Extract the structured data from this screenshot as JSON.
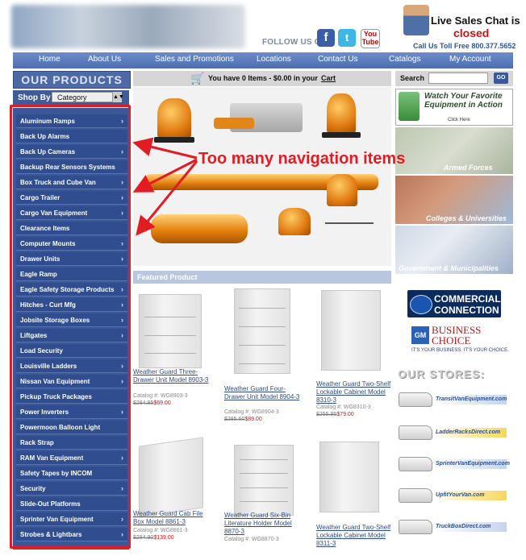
{
  "header": {
    "follow_us": "FOLLOW US ON",
    "social": {
      "facebook": "f",
      "twitter": "t",
      "youtube": "You Tube"
    },
    "chat_title": "Live Sales Chat is",
    "chat_status": "closed",
    "phone": "Call Us Toll Free 800.377.5652"
  },
  "nav": [
    "Home",
    "About Us",
    "Sales and Promotions",
    "Locations",
    "Contact Us",
    "Catalogs",
    "My Account"
  ],
  "sidebar": {
    "title": "OUR PRODUCTS",
    "shop_by": "Shop By",
    "category": "Category",
    "items": [
      {
        "label": "Aluminum Ramps",
        "arrow": true
      },
      {
        "label": "Back Up Alarms",
        "arrow": false
      },
      {
        "label": "Back Up Cameras",
        "arrow": true
      },
      {
        "label": "Backup Rear Sensors Systems",
        "arrow": false
      },
      {
        "label": "Box Truck and Cube Van",
        "arrow": true
      },
      {
        "label": "Cargo Trailer",
        "arrow": true
      },
      {
        "label": "Cargo Van Equipment",
        "arrow": true
      },
      {
        "label": "Clearance Items",
        "arrow": false
      },
      {
        "label": "Computer Mounts",
        "arrow": true
      },
      {
        "label": "Drawer Units",
        "arrow": true
      },
      {
        "label": "Eagle Ramp",
        "arrow": false
      },
      {
        "label": "Eagle Safety Storage Products",
        "arrow": true
      },
      {
        "label": "Hitches - Curt Mfg",
        "arrow": true
      },
      {
        "label": "Jobsite Storage Boxes",
        "arrow": true
      },
      {
        "label": "Liftgates",
        "arrow": true
      },
      {
        "label": "Load Security",
        "arrow": false
      },
      {
        "label": "Louisville Ladders",
        "arrow": true
      },
      {
        "label": "Nissan Van Equipment",
        "arrow": true
      },
      {
        "label": "Pickup Truck Packages",
        "arrow": false
      },
      {
        "label": "Power Inverters",
        "arrow": true
      },
      {
        "label": "Powermoon Balloon Light",
        "arrow": false
      },
      {
        "label": "Rack Strap",
        "arrow": false
      },
      {
        "label": "RAM Van Equipment",
        "arrow": true
      },
      {
        "label": "Safety Tapes by INCOM",
        "arrow": false
      },
      {
        "label": "Security",
        "arrow": true
      },
      {
        "label": "Slide-Out Platforms",
        "arrow": false
      },
      {
        "label": "Sprinter Van Equipment",
        "arrow": true
      },
      {
        "label": "Strobes & Lightbars",
        "arrow": true
      }
    ],
    "arrow_glyph": "›"
  },
  "cart": {
    "text": "You have 0 Items - $0.00 in your",
    "link": "Cart"
  },
  "search": {
    "label": "Search",
    "go": "GO"
  },
  "featured": {
    "title": "Featured Product",
    "products": [
      {
        "name": "Weather Guard Three-Drawer Unit Model 8903-3",
        "catalog": "Catalog #: WG8903-3",
        "old_price": "$284.85",
        "price": "$69.00"
      },
      {
        "name": "Weather Guard Four-Drawer Unit Model 8904-3",
        "catalog": "Catalog #: WG8904-3",
        "old_price": "$285.60",
        "price": "$89.00"
      },
      {
        "name": "Weather Guard Two-Shelf Lockable Cabinet Model 8310-3",
        "catalog": "Catalog #: WG8310-3",
        "old_price": "$255.85",
        "price": "$79.00"
      },
      {
        "name": "Weather Guard Cab File Box Model 8861-3",
        "catalog": "Catalog #: WG8861-3",
        "old_price": "$284.90",
        "price": "$139.00"
      },
      {
        "name": "Weather Guard Six-Bin Literature Holder Model 8870-3",
        "catalog": "Catalog #: WG8870-3",
        "old_price": "",
        "price": ""
      },
      {
        "name": "Weather Guard Two-Shelf Lockable Cabinet Model 8311-3",
        "catalog": "",
        "old_price": "",
        "price": ""
      }
    ]
  },
  "right": {
    "wyf_banner": "Watch Your Favorite Equipment in Action",
    "wyf_sub": "Click Here",
    "armed_forces": "Armed Forces",
    "colleges": "Colleges & Universities",
    "government": "Government & Municipalities",
    "ford_line1": "COMMERCIAL",
    "ford_line2": "CONNECTION",
    "gm": "GM",
    "bc_business": "BUSINESS",
    "bc_choice": "CHOICE",
    "bc_tagline": "IT'S YOUR BUSINESS. IT'S YOUR CHOICE.",
    "our_stores": "OUR STORES:",
    "stores": [
      "TransitVanEquipment.com",
      "LadderRacksDirect.com",
      "SprinterVanEquipment.com",
      "UpfitYourVan.com",
      "TruckBoxDirect.com"
    ]
  },
  "annotation": "Too many navigation items",
  "colors": {
    "annotation": "#e31b23",
    "nav": "#4d6eb1",
    "sidebar": "#304d8f"
  }
}
